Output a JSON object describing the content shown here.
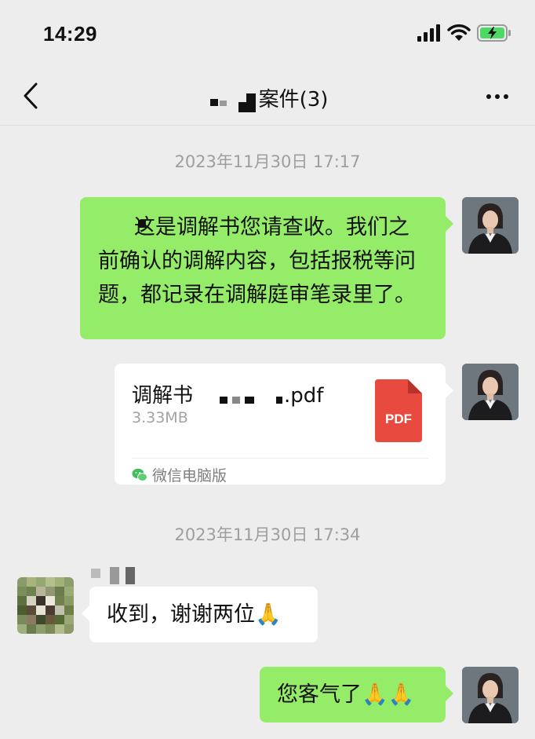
{
  "status_bar": {
    "time": "14:29"
  },
  "nav": {
    "title": "案件(3)"
  },
  "messages": {
    "ts1": "2023年11月30日 17:17",
    "msg1": "这是调解书您请查收。我们之前确认的调解内容，包括报税等问题，都记录在调解庭审笔录里了。",
    "file": {
      "name_prefix": "调解书",
      "name_suffix": ".pdf",
      "size": "3.33MB",
      "badge": "PDF",
      "source": "微信电脑版"
    },
    "ts2": "2023年11月30日 17:34",
    "msg2": "收到，谢谢两位🙏",
    "msg3": "您客气了🙏🙏"
  },
  "colors": {
    "background": "#ededed",
    "self_bubble": "#95ec69",
    "other_bubble": "#ffffff",
    "pdf_red": "#e84a3f",
    "battery_green": "#4cd964"
  }
}
